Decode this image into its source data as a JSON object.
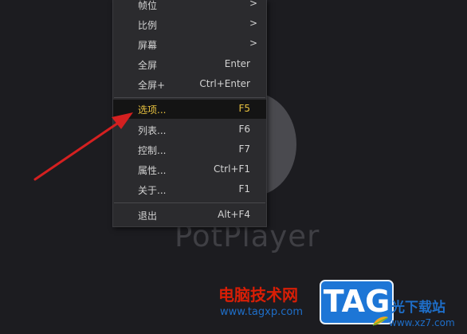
{
  "background": {
    "logo_text": "PotPlayer"
  },
  "menu": {
    "top_items": [
      {
        "label": "帧位",
        "shortcut": "",
        "has_submenu": true
      },
      {
        "label": "比例",
        "shortcut": "",
        "has_submenu": true
      },
      {
        "label": "屏幕",
        "shortcut": "",
        "has_submenu": true
      },
      {
        "label": "全屏",
        "shortcut": "Enter",
        "has_submenu": false
      },
      {
        "label": "全屏+",
        "shortcut": "Ctrl+Enter",
        "has_submenu": false
      }
    ],
    "mid_items": [
      {
        "label": "选项...",
        "shortcut": "F5",
        "highlighted": true
      },
      {
        "label": "列表...",
        "shortcut": "F6"
      },
      {
        "label": "控制...",
        "shortcut": "F7"
      },
      {
        "label": "属性...",
        "shortcut": "Ctrl+F1"
      },
      {
        "label": "关于...",
        "shortcut": "F1"
      }
    ],
    "bottom_items": [
      {
        "label": "退出",
        "shortcut": "Alt+F4"
      }
    ],
    "submenu_arrow": ">"
  },
  "watermark": {
    "left_cn": "电脑技术网",
    "left_url": "www.tagxp.com",
    "badge": "TAG",
    "right_cn": "光下载站",
    "right_url": "www.xz7.com"
  },
  "colors": {
    "highlight_text": "#e8c23f",
    "arrow_red": "#d42020",
    "watermark_red": "#d81e06",
    "watermark_blue": "#1d76d6"
  }
}
